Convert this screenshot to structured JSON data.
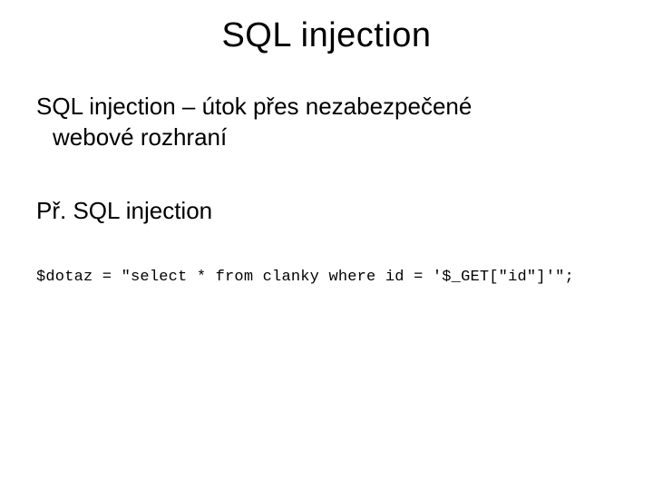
{
  "title": "SQL injection",
  "subtitle_line1": "SQL injection – útok přes nezabezpečené",
  "subtitle_line2": "webové rozhraní",
  "example_heading": "Př. SQL injection",
  "code_line": "$dotaz = \"select * from clanky where id = '$_GET[\"id\"]'\";"
}
